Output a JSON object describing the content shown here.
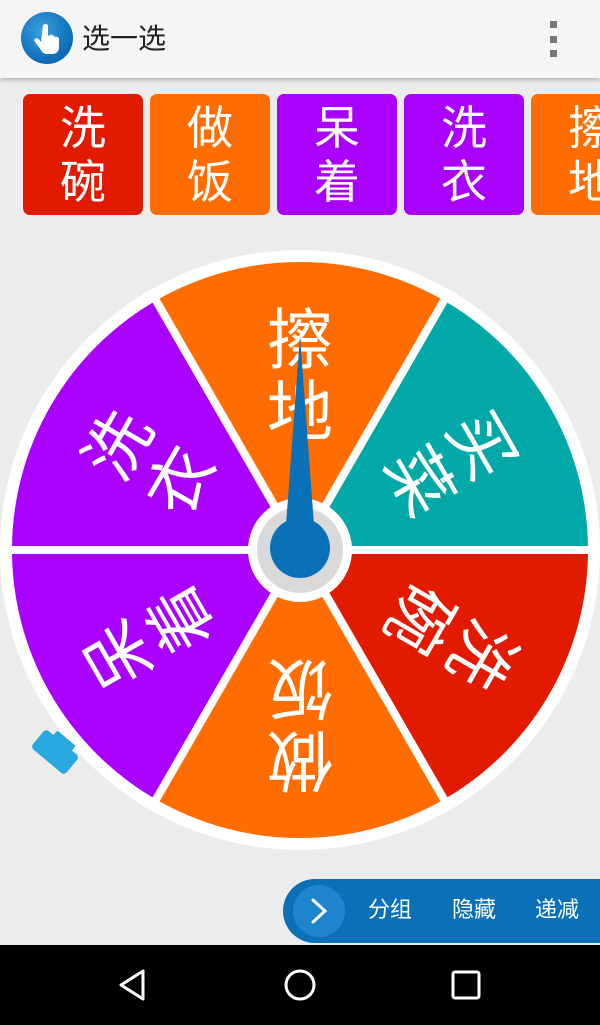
{
  "app": {
    "title": "选一选",
    "icon": "pointing-hand-icon",
    "accent_color": "#0a70b8"
  },
  "chips": [
    {
      "lines": [
        "洗",
        "碗"
      ],
      "color": "#e21a00"
    },
    {
      "lines": [
        "做",
        "饭"
      ],
      "color": "#ff6d00"
    },
    {
      "lines": [
        "呆",
        "着"
      ],
      "color": "#aa00ff"
    },
    {
      "lines": [
        "洗",
        "衣"
      ],
      "color": "#aa00ff"
    },
    {
      "lines": [
        "擦",
        "地"
      ],
      "color": "#ff6d00"
    }
  ],
  "wheel": {
    "segments": [
      {
        "lines": [
          "擦",
          "地"
        ],
        "color": "#ff6d00"
      },
      {
        "lines": [
          "买",
          "菜"
        ],
        "color": "#00a8a8"
      },
      {
        "lines": [
          "洗",
          "碗"
        ],
        "color": "#e21a00"
      },
      {
        "lines": [
          "做",
          "饭"
        ],
        "color": "#ff6d00"
      },
      {
        "lines": [
          "呆",
          "着"
        ],
        "color": "#aa00ff"
      },
      {
        "lines": [
          "洗",
          "衣"
        ],
        "color": "#aa00ff"
      }
    ],
    "pointer_color": "#0a70b8",
    "handle_color": "#29a8e0"
  },
  "toolbar": {
    "expand_icon": "chevron-right-icon",
    "buttons": [
      "分组",
      "隐藏",
      "递减"
    ]
  },
  "navbar": {
    "back_icon": "back-triangle-icon",
    "home_icon": "home-circle-icon",
    "recents_icon": "recents-square-icon"
  }
}
